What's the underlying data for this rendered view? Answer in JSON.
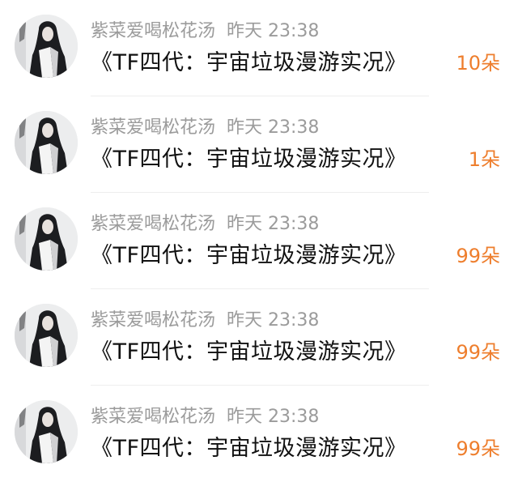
{
  "gifts": [
    {
      "username": "紫菜爱喝松花汤",
      "time": "昨天 23:38",
      "title": "《TF四代：宇宙垃圾漫游实况》",
      "count": "10朵"
    },
    {
      "username": "紫菜爱喝松花汤",
      "time": "昨天 23:38",
      "title": "《TF四代：宇宙垃圾漫游实况》",
      "count": "1朵"
    },
    {
      "username": "紫菜爱喝松花汤",
      "time": "昨天 23:38",
      "title": "《TF四代：宇宙垃圾漫游实况》",
      "count": "99朵"
    },
    {
      "username": "紫菜爱喝松花汤",
      "time": "昨天 23:38",
      "title": "《TF四代：宇宙垃圾漫游实况》",
      "count": "99朵"
    },
    {
      "username": "紫菜爱喝松花汤",
      "time": "昨天 23:38",
      "title": "《TF四代：宇宙垃圾漫游实况》",
      "count": "99朵"
    }
  ],
  "colors": {
    "count": "#ee7e2d",
    "meta": "#9b9b9b",
    "title": "#111111"
  }
}
